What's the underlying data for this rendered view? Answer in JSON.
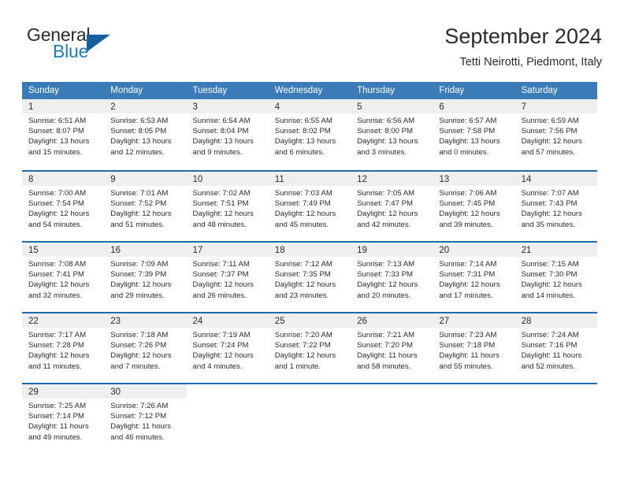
{
  "brand": {
    "name_top": "General",
    "name_bottom": "Blue",
    "accent_color": "#1f7bc1",
    "triangle_color": "#17609e"
  },
  "header": {
    "title": "September 2024",
    "subtitle": "Tetti Neirotti, Piedmont, Italy"
  },
  "theme": {
    "header_row_bg": "#3b7cb8",
    "row_divider": "#1f6cb0",
    "daynum_band_bg": "#efefef",
    "text": "#2b2b2b"
  },
  "weekdays": [
    "Sunday",
    "Monday",
    "Tuesday",
    "Wednesday",
    "Thursday",
    "Friday",
    "Saturday"
  ],
  "weeks": [
    [
      {
        "day": "1",
        "sunrise": "Sunrise: 6:51 AM",
        "sunset": "Sunset: 8:07 PM",
        "daylight1": "Daylight: 13 hours",
        "daylight2": "and 15 minutes."
      },
      {
        "day": "2",
        "sunrise": "Sunrise: 6:53 AM",
        "sunset": "Sunset: 8:05 PM",
        "daylight1": "Daylight: 13 hours",
        "daylight2": "and 12 minutes."
      },
      {
        "day": "3",
        "sunrise": "Sunrise: 6:54 AM",
        "sunset": "Sunset: 8:04 PM",
        "daylight1": "Daylight: 13 hours",
        "daylight2": "and 9 minutes."
      },
      {
        "day": "4",
        "sunrise": "Sunrise: 6:55 AM",
        "sunset": "Sunset: 8:02 PM",
        "daylight1": "Daylight: 13 hours",
        "daylight2": "and 6 minutes."
      },
      {
        "day": "5",
        "sunrise": "Sunrise: 6:56 AM",
        "sunset": "Sunset: 8:00 PM",
        "daylight1": "Daylight: 13 hours",
        "daylight2": "and 3 minutes."
      },
      {
        "day": "6",
        "sunrise": "Sunrise: 6:57 AM",
        "sunset": "Sunset: 7:58 PM",
        "daylight1": "Daylight: 13 hours",
        "daylight2": "and 0 minutes."
      },
      {
        "day": "7",
        "sunrise": "Sunrise: 6:59 AM",
        "sunset": "Sunset: 7:56 PM",
        "daylight1": "Daylight: 12 hours",
        "daylight2": "and 57 minutes."
      }
    ],
    [
      {
        "day": "8",
        "sunrise": "Sunrise: 7:00 AM",
        "sunset": "Sunset: 7:54 PM",
        "daylight1": "Daylight: 12 hours",
        "daylight2": "and 54 minutes."
      },
      {
        "day": "9",
        "sunrise": "Sunrise: 7:01 AM",
        "sunset": "Sunset: 7:52 PM",
        "daylight1": "Daylight: 12 hours",
        "daylight2": "and 51 minutes."
      },
      {
        "day": "10",
        "sunrise": "Sunrise: 7:02 AM",
        "sunset": "Sunset: 7:51 PM",
        "daylight1": "Daylight: 12 hours",
        "daylight2": "and 48 minutes."
      },
      {
        "day": "11",
        "sunrise": "Sunrise: 7:03 AM",
        "sunset": "Sunset: 7:49 PM",
        "daylight1": "Daylight: 12 hours",
        "daylight2": "and 45 minutes."
      },
      {
        "day": "12",
        "sunrise": "Sunrise: 7:05 AM",
        "sunset": "Sunset: 7:47 PM",
        "daylight1": "Daylight: 12 hours",
        "daylight2": "and 42 minutes."
      },
      {
        "day": "13",
        "sunrise": "Sunrise: 7:06 AM",
        "sunset": "Sunset: 7:45 PM",
        "daylight1": "Daylight: 12 hours",
        "daylight2": "and 39 minutes."
      },
      {
        "day": "14",
        "sunrise": "Sunrise: 7:07 AM",
        "sunset": "Sunset: 7:43 PM",
        "daylight1": "Daylight: 12 hours",
        "daylight2": "and 35 minutes."
      }
    ],
    [
      {
        "day": "15",
        "sunrise": "Sunrise: 7:08 AM",
        "sunset": "Sunset: 7:41 PM",
        "daylight1": "Daylight: 12 hours",
        "daylight2": "and 32 minutes."
      },
      {
        "day": "16",
        "sunrise": "Sunrise: 7:09 AM",
        "sunset": "Sunset: 7:39 PM",
        "daylight1": "Daylight: 12 hours",
        "daylight2": "and 29 minutes."
      },
      {
        "day": "17",
        "sunrise": "Sunrise: 7:11 AM",
        "sunset": "Sunset: 7:37 PM",
        "daylight1": "Daylight: 12 hours",
        "daylight2": "and 26 minutes."
      },
      {
        "day": "18",
        "sunrise": "Sunrise: 7:12 AM",
        "sunset": "Sunset: 7:35 PM",
        "daylight1": "Daylight: 12 hours",
        "daylight2": "and 23 minutes."
      },
      {
        "day": "19",
        "sunrise": "Sunrise: 7:13 AM",
        "sunset": "Sunset: 7:33 PM",
        "daylight1": "Daylight: 12 hours",
        "daylight2": "and 20 minutes."
      },
      {
        "day": "20",
        "sunrise": "Sunrise: 7:14 AM",
        "sunset": "Sunset: 7:31 PM",
        "daylight1": "Daylight: 12 hours",
        "daylight2": "and 17 minutes."
      },
      {
        "day": "21",
        "sunrise": "Sunrise: 7:15 AM",
        "sunset": "Sunset: 7:30 PM",
        "daylight1": "Daylight: 12 hours",
        "daylight2": "and 14 minutes."
      }
    ],
    [
      {
        "day": "22",
        "sunrise": "Sunrise: 7:17 AM",
        "sunset": "Sunset: 7:28 PM",
        "daylight1": "Daylight: 12 hours",
        "daylight2": "and 11 minutes."
      },
      {
        "day": "23",
        "sunrise": "Sunrise: 7:18 AM",
        "sunset": "Sunset: 7:26 PM",
        "daylight1": "Daylight: 12 hours",
        "daylight2": "and 7 minutes."
      },
      {
        "day": "24",
        "sunrise": "Sunrise: 7:19 AM",
        "sunset": "Sunset: 7:24 PM",
        "daylight1": "Daylight: 12 hours",
        "daylight2": "and 4 minutes."
      },
      {
        "day": "25",
        "sunrise": "Sunrise: 7:20 AM",
        "sunset": "Sunset: 7:22 PM",
        "daylight1": "Daylight: 12 hours",
        "daylight2": "and 1 minute."
      },
      {
        "day": "26",
        "sunrise": "Sunrise: 7:21 AM",
        "sunset": "Sunset: 7:20 PM",
        "daylight1": "Daylight: 11 hours",
        "daylight2": "and 58 minutes."
      },
      {
        "day": "27",
        "sunrise": "Sunrise: 7:23 AM",
        "sunset": "Sunset: 7:18 PM",
        "daylight1": "Daylight: 11 hours",
        "daylight2": "and 55 minutes."
      },
      {
        "day": "28",
        "sunrise": "Sunrise: 7:24 AM",
        "sunset": "Sunset: 7:16 PM",
        "daylight1": "Daylight: 11 hours",
        "daylight2": "and 52 minutes."
      }
    ],
    [
      {
        "day": "29",
        "sunrise": "Sunrise: 7:25 AM",
        "sunset": "Sunset: 7:14 PM",
        "daylight1": "Daylight: 11 hours",
        "daylight2": "and 49 minutes."
      },
      {
        "day": "30",
        "sunrise": "Sunrise: 7:26 AM",
        "sunset": "Sunset: 7:12 PM",
        "daylight1": "Daylight: 11 hours",
        "daylight2": "and 46 minutes."
      },
      null,
      null,
      null,
      null,
      null
    ]
  ]
}
